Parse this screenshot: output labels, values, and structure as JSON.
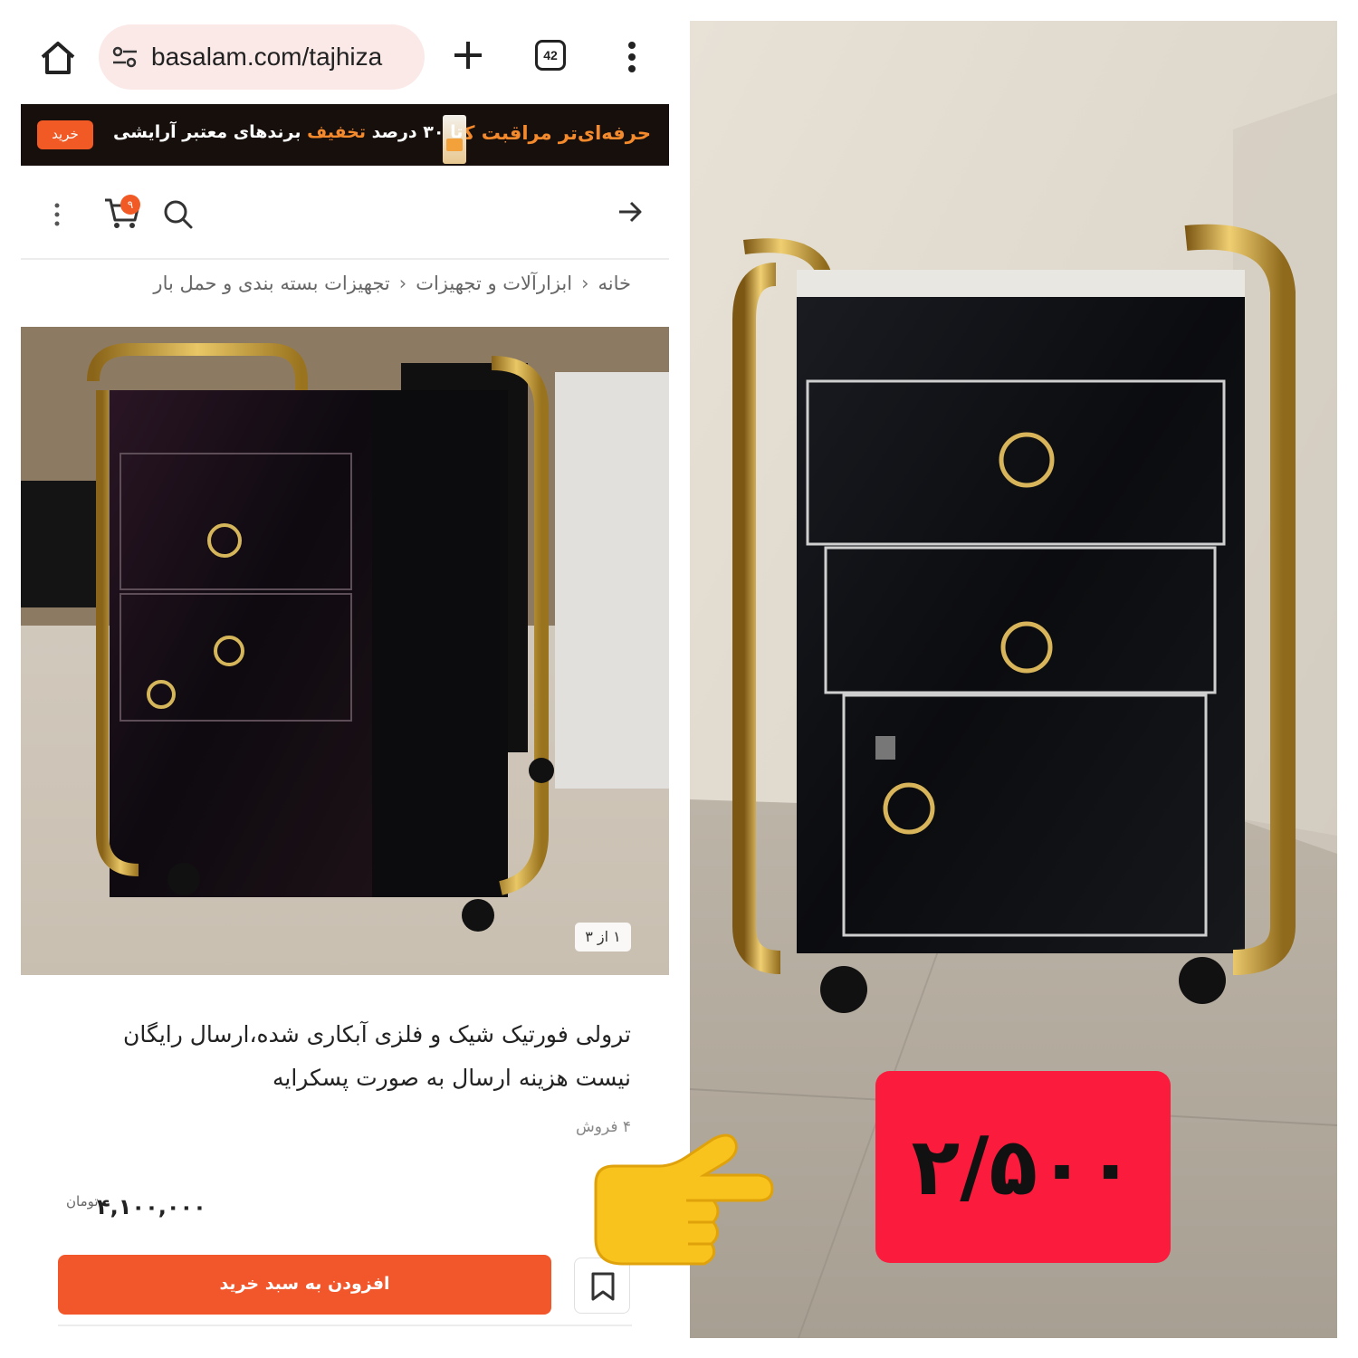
{
  "browser": {
    "url": "basalam.com/tajhiza",
    "tab_count": "42"
  },
  "banner": {
    "title": "حرفه‌ای‌تر مراقبت کن",
    "offer_prefix": "تا ۳۰ درصد",
    "offer_highlight": "تخفیف",
    "offer_suffix": "برندهای معتبر آرایشی",
    "button": "خرید"
  },
  "toolbar": {
    "cart_count": "۹"
  },
  "breadcrumb": {
    "items": [
      "خانه",
      "ابزارآلات و تجهیزات",
      "تجهیزات بسته بندی و حمل بار"
    ]
  },
  "gallery": {
    "counter": "۱ از ۳"
  },
  "product": {
    "title": "ترولی فورتیک شیک و فلزی آبکاری شده،ارسال رایگان نیست هزینه ارسال به صورت پسکرایه",
    "sales": "۴ فروش",
    "price": "۴,۱۰۰,۰۰۰",
    "currency": "تومان",
    "add_to_cart": "افزودن به سبد خرید"
  },
  "overlay": {
    "price_tag": "۲/۵۰۰"
  },
  "colors": {
    "accent": "#f2572c",
    "banner_bg": "#170f0c",
    "price_tag_bg": "#fb1b3c"
  }
}
